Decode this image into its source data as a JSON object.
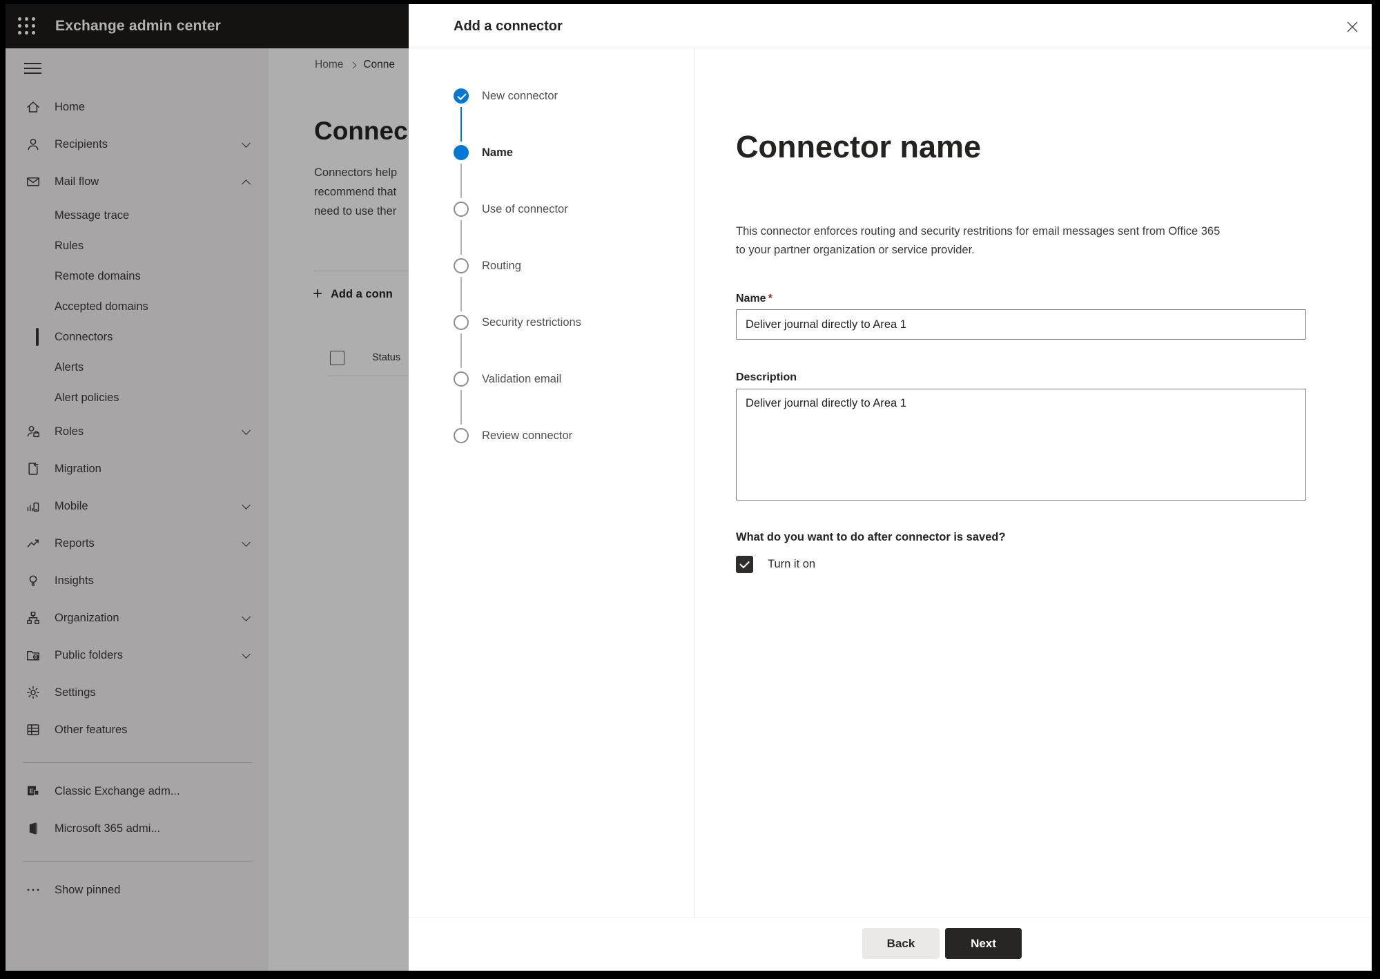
{
  "topbar": {
    "title": "Exchange admin center"
  },
  "sidebar": {
    "items": [
      {
        "label": "Home",
        "icon": "home"
      },
      {
        "label": "Recipients",
        "icon": "recipients",
        "chevron": "down"
      },
      {
        "label": "Mail flow",
        "icon": "mail-flow",
        "chevron": "up"
      },
      {
        "label": "Message trace",
        "sub": true
      },
      {
        "label": "Rules",
        "sub": true
      },
      {
        "label": "Remote domains",
        "sub": true
      },
      {
        "label": "Accepted domains",
        "sub": true
      },
      {
        "label": "Connectors",
        "sub": true,
        "selected": true
      },
      {
        "label": "Alerts",
        "sub": true
      },
      {
        "label": "Alert policies",
        "sub": true
      },
      {
        "label": "Roles",
        "icon": "roles",
        "chevron": "down"
      },
      {
        "label": "Migration",
        "icon": "migration"
      },
      {
        "label": "Mobile",
        "icon": "mobile",
        "chevron": "down"
      },
      {
        "label": "Reports",
        "icon": "reports",
        "chevron": "down"
      },
      {
        "label": "Insights",
        "icon": "insights"
      },
      {
        "label": "Organization",
        "icon": "organization",
        "chevron": "down"
      },
      {
        "label": "Public folders",
        "icon": "public-folders",
        "chevron": "down"
      },
      {
        "label": "Settings",
        "icon": "settings"
      },
      {
        "label": "Other features",
        "icon": "other-features"
      }
    ],
    "footer_items": [
      {
        "label": "Classic Exchange adm...",
        "icon": "classic-exchange"
      },
      {
        "label": "Microsoft 365 admi...",
        "icon": "microsoft-365"
      }
    ],
    "pinned_item": {
      "label": "Show pinned",
      "icon": "show-pinned"
    }
  },
  "background_page": {
    "breadcrumb": {
      "home": "Home",
      "current": "Conne"
    },
    "title_clipped": "Connec",
    "paragraph_lines": [
      "Connectors help",
      "recommend that",
      "need to use ther"
    ],
    "add_button_label": "Add a conn",
    "table": {
      "select_all_checked": false,
      "status_header": "Status"
    }
  },
  "dialog": {
    "title": "Add a connector",
    "steps": [
      {
        "label": "New connector",
        "state": "completed"
      },
      {
        "label": "Name",
        "state": "current"
      },
      {
        "label": "Use of connector",
        "state": "upcoming"
      },
      {
        "label": "Routing",
        "state": "upcoming"
      },
      {
        "label": "Security restrictions",
        "state": "upcoming"
      },
      {
        "label": "Validation email",
        "state": "upcoming"
      },
      {
        "label": "Review connector",
        "state": "upcoming"
      }
    ],
    "content": {
      "heading": "Connector name",
      "description_line1": "This connector enforces routing and security restritions for email messages sent from Office 365",
      "description_line2": "to your partner organization or service provider.",
      "name_label": "Name",
      "required_marker": "*",
      "name_value": "Deliver journal directly to Area 1",
      "description_label": "Description",
      "description_value": "Deliver journal directly to Area 1",
      "after_save_question": "What do you want to do after connector is saved?",
      "turn_on_label": "Turn it on",
      "turn_on_checked": true
    },
    "footer": {
      "back_label": "Back",
      "next_label": "Next"
    }
  },
  "colors": {
    "accent": "#0078d4",
    "required": "#a4262c",
    "topbar": "#1d1c1b"
  }
}
